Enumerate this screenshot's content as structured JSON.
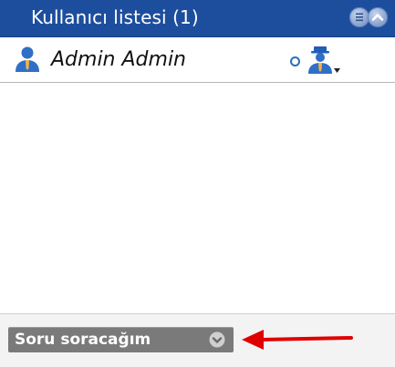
{
  "header": {
    "title": "Kullanıcı listesi (1)",
    "menu_icon": "menu-lines-icon",
    "collapse_icon": "chevron-up-icon",
    "background_color": "#1d4e9e"
  },
  "users": [
    {
      "name": "Admin Admin",
      "avatar_icon": "user-icon",
      "status_icon": "status-ring-icon",
      "role_icon": "moderator-user-icon"
    }
  ],
  "footer": {
    "select_value": "Soru soracağım",
    "select_icon": "chevron-down-icon",
    "annotation_icon": "red-arrow-left-icon",
    "annotation_color": "#e00000"
  }
}
